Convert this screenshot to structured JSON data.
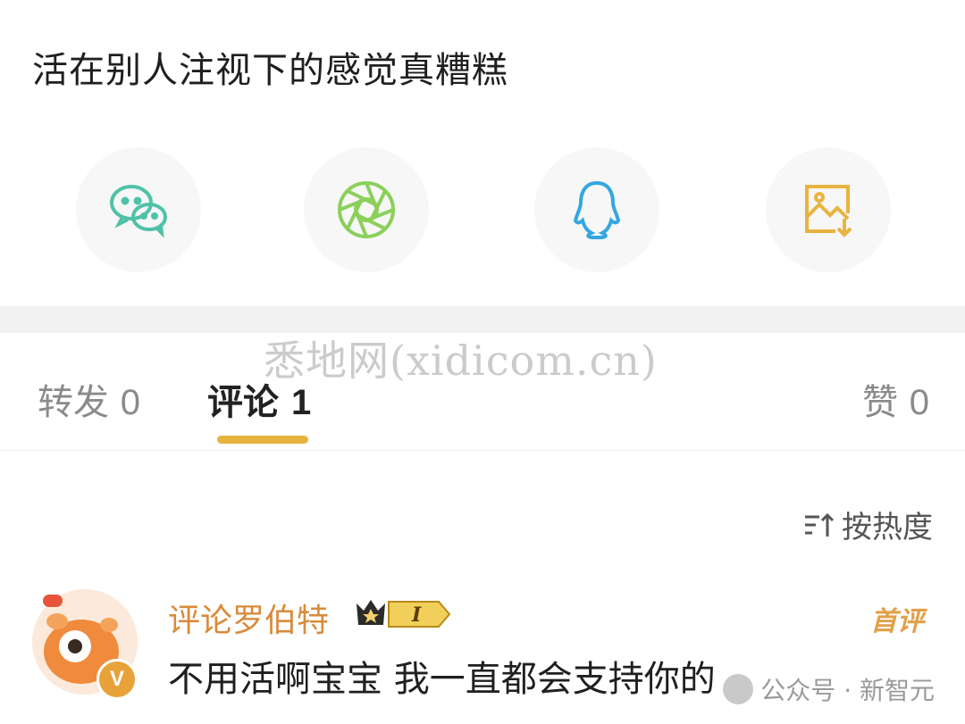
{
  "post": {
    "text": "活在别人注视下的感觉真糟糕"
  },
  "share": {
    "items": [
      {
        "icon": "wechat-icon",
        "color": "#4fc2a7"
      },
      {
        "icon": "moments-icon",
        "color": "#8bd05a"
      },
      {
        "icon": "qq-icon",
        "color": "#34a7e0"
      },
      {
        "icon": "save-image-icon",
        "color": "#e9b33f"
      }
    ]
  },
  "watermark": "悉地网(xidicom.cn)",
  "tabs": {
    "repost": {
      "label": "转发",
      "count": "0"
    },
    "comment": {
      "label": "评论",
      "count": "1"
    },
    "like": {
      "label": "赞",
      "count": "0"
    }
  },
  "sort": {
    "label": "按热度"
  },
  "comments": [
    {
      "user": "评论罗伯特",
      "level": "I",
      "first_tag": "首评",
      "avatar_badge": "V",
      "text": "不用活啊宝宝 我一直都会支持你的"
    }
  ],
  "credit": {
    "text": "公众号 · 新智元"
  },
  "colors": {
    "accent": "#e7b23d",
    "username": "#d98a3a"
  }
}
